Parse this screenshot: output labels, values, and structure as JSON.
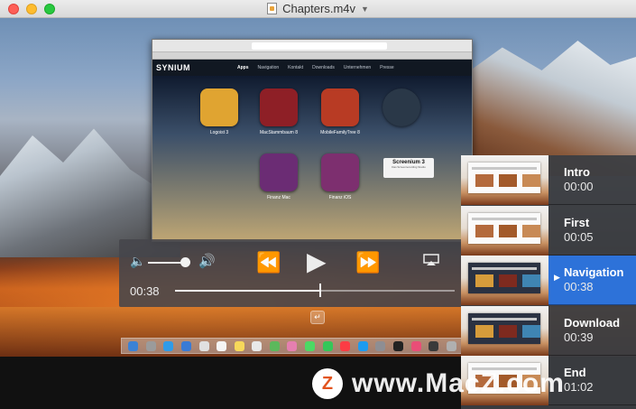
{
  "window": {
    "title": "Chapters.m4v"
  },
  "browser": {
    "logo": "SYNIUM",
    "nav": [
      "Apps",
      "Navigation",
      "Kontakt",
      "Downloads",
      "Unternehmen",
      "Presse"
    ],
    "apps": [
      {
        "label": "Logoist 3",
        "color": "#e0a431"
      },
      {
        "label": "MacStammbaum 8",
        "color": "#8e1f26"
      },
      {
        "label": "MobileFamilyTree 8",
        "color": "#b83b24"
      },
      {
        "label": "Screenium 3",
        "color": "#2a3848"
      },
      {
        "label": "Finanz Mac",
        "color": "#6b2c74"
      },
      {
        "label": "Finanz iOS",
        "color": "#7d2f6f"
      }
    ],
    "tooltip_title": "Screenium 3",
    "tooltip_sub": "Das Screenrecording Studio"
  },
  "player": {
    "current_time": "00:38",
    "progress": 0.52,
    "volume": 0.85
  },
  "chapters": [
    {
      "name": "Intro",
      "time": "00:00",
      "selected": false
    },
    {
      "name": "First",
      "time": "00:05",
      "selected": false
    },
    {
      "name": "Navigation",
      "time": "00:38",
      "selected": true
    },
    {
      "name": "Download",
      "time": "00:39",
      "selected": false
    },
    {
      "name": "End",
      "time": "01:02",
      "selected": false
    }
  ],
  "watermark": {
    "badge": "Z",
    "text": "www.MacZ.com"
  },
  "colors": {
    "accent": "#2d72d9"
  }
}
